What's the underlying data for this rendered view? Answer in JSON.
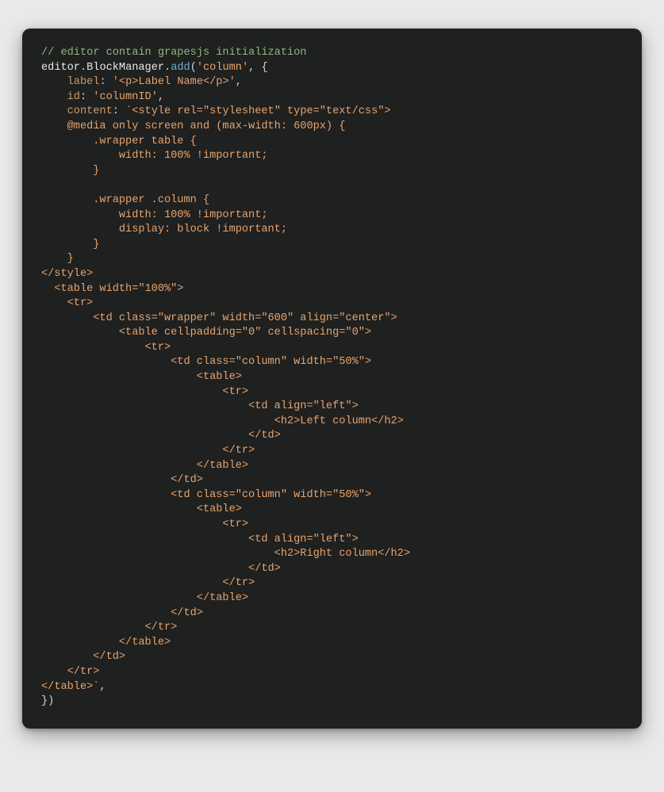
{
  "code": {
    "l01a": "// editor contain grapesjs initialization",
    "l02a": "editor",
    "l02b": ".",
    "l02c": "BlockManager",
    "l02d": ".",
    "l02e": "add",
    "l02f": "(",
    "l02g": "'column'",
    "l02h": ", {",
    "l03a": "    ",
    "l03b": "label",
    "l03c": ": ",
    "l03d": "'<p>Label Name</p>'",
    "l03e": ",",
    "l04a": "    ",
    "l04b": "id",
    "l04c": ": ",
    "l04d": "'columnID'",
    "l04e": ",",
    "l05a": "    ",
    "l05b": "content",
    "l05c": ": ",
    "l05d": "`<style rel=\"stylesheet\" type=\"text/css\">",
    "l06": "    @media only screen and (max-width: 600px) {",
    "l07": "        .wrapper table {",
    "l08": "            width: 100% !important;",
    "l09": "        }",
    "l10": "",
    "l11": "        .wrapper .column {",
    "l12": "            width: 100% !important;",
    "l13": "            display: block !important;",
    "l14": "        }",
    "l15": "    }",
    "l16": "</style>",
    "l17": "  <table width=\"100%\">",
    "l18": "    <tr>",
    "l19": "        <td class=\"wrapper\" width=\"600\" align=\"center\">",
    "l20": "            <table cellpadding=\"0\" cellspacing=\"0\">",
    "l21": "                <tr>",
    "l22": "                    <td class=\"column\" width=\"50%\">",
    "l23": "                        <table>",
    "l24": "                            <tr>",
    "l25": "                                <td align=\"left\">",
    "l26": "                                    <h2>Left column</h2>",
    "l27": "                                </td>",
    "l28": "                            </tr>",
    "l29": "                        </table>",
    "l30": "                    </td>",
    "l31": "                    <td class=\"column\" width=\"50%\">",
    "l32": "                        <table>",
    "l33": "                            <tr>",
    "l34": "                                <td align=\"left\">",
    "l35": "                                    <h2>Right column</h2>",
    "l36": "                                </td>",
    "l37": "                            </tr>",
    "l38": "                        </table>",
    "l39": "                    </td>",
    "l40": "                </tr>",
    "l41": "            </table>",
    "l42": "        </td>",
    "l43": "    </tr>",
    "l44": "</table>`",
    "l44b": ",",
    "l45": "})"
  }
}
